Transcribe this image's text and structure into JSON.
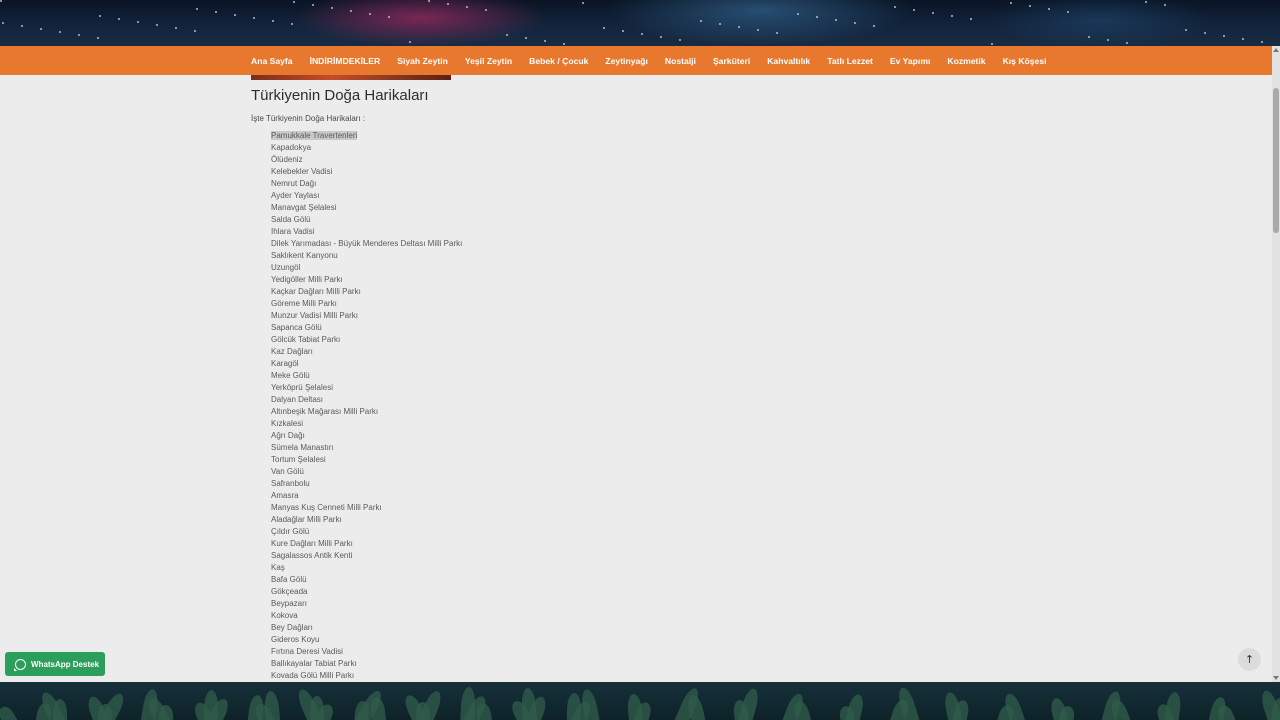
{
  "nav": {
    "items": [
      "Ana Sayfa",
      "İNDİRİMDEKİLER",
      "Siyah Zeytin",
      "Yeşil Zeytin",
      "Bebek / Çocuk",
      "Zeytinyağı",
      "Nostalji",
      "Şarküteri",
      "Kahvaltılık",
      "Tatlı Lezzet",
      "Ev Yapımı",
      "Kozmetik",
      "Kış Köşesi"
    ]
  },
  "article": {
    "title": "Türkiyenin Doğa Harikaları",
    "intro": "İşte Türkiyenin Doğa Harikaları :",
    "places": [
      "Pamukkale Travertenleri",
      "Kapadokya",
      "Ölüdeniz",
      "Kelebekler Vadisi",
      "Nemrut Dağı",
      "Ayder Yaylası",
      "Manavgat Şelalesi",
      "Salda Gölü",
      "Ihlara Vadisi",
      "Dilek Yarımadası - Büyük Menderes Deltası Milli Parkı",
      "Saklıkent Kanyonu",
      "Uzungöl",
      "Yedigöller Milli Parkı",
      "Kaçkar Dağları Milli Parkı",
      "Göreme Milli Parkı",
      "Munzur Vadisi Milli Parkı",
      "Sapanca Gölü",
      "Gölcük Tabiat Parkı",
      "Kaz Dağları",
      "Karagöl",
      "Meke Gölü",
      "Yerköprü Şelalesi",
      "Dalyan Deltası",
      "Altınbeşik Mağarası Milli Parkı",
      "Kızkalesi",
      "Ağrı Dağı",
      "Sümela Manastırı",
      "Tortum Şelalesi",
      "Van Gölü",
      "Safranbolu",
      "Amasra",
      "Manyas Kuş Cenneti Milli Parkı",
      "Aladağlar Milli Parkı",
      "Çıldır Gölü",
      "Kure Dağları Milli Parkı",
      "Sagalassos Antik Kenti",
      "Kaş",
      "Bafa Gölü",
      "Gökçeada",
      "Beypazarı",
      "Kokova",
      "Bey Dağları",
      "Gideros Koyu",
      "Fırtına Deresi Vadisi",
      "Ballıkayalar Tabiat Parkı",
      "Kovada Gölü Milli Parkı"
    ],
    "highlighted_index": 0
  },
  "whatsapp": {
    "label": "WhatsApp Destek",
    "color": "#2c9e5c"
  },
  "colors": {
    "nav_bg": "#e8782e",
    "content_bg": "#ececec"
  },
  "icons": {
    "whatsapp": "whatsapp-icon",
    "back_to_top": "arrow-up-icon"
  }
}
